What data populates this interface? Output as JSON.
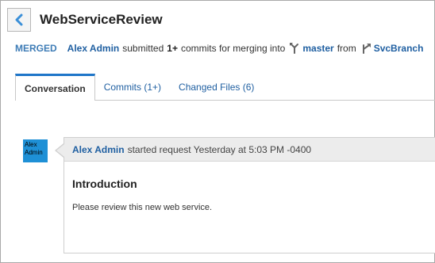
{
  "header": {
    "title": "WebServiceReview",
    "back_icon": "chevron-left-icon"
  },
  "merge_info": {
    "status": "MERGED",
    "author": "Alex Admin",
    "submitted_text": "submitted",
    "commit_count": "1+",
    "commits_text": "commits for merging into",
    "target_branch": "master",
    "from_text": "from",
    "source_branch": "SvcBranch",
    "target_icon": "merge-branch-icon",
    "source_icon": "branch-icon"
  },
  "tabs": [
    {
      "label": "Conversation",
      "active": true
    },
    {
      "label": "Commits (1+)",
      "active": false
    },
    {
      "label": "Changed Files (6)",
      "active": false
    }
  ],
  "conversation": {
    "avatar_text": "Alex Admin",
    "author": "Alex Admin",
    "action_text": "started request Yesterday at 5:03 PM -0400",
    "heading": "Introduction",
    "body": "Please review this new web service."
  },
  "colors": {
    "accent": "#1f76c9",
    "link": "#1f5fa1",
    "status": "#3e7cb6",
    "avatar_bg": "#1e90d6"
  }
}
